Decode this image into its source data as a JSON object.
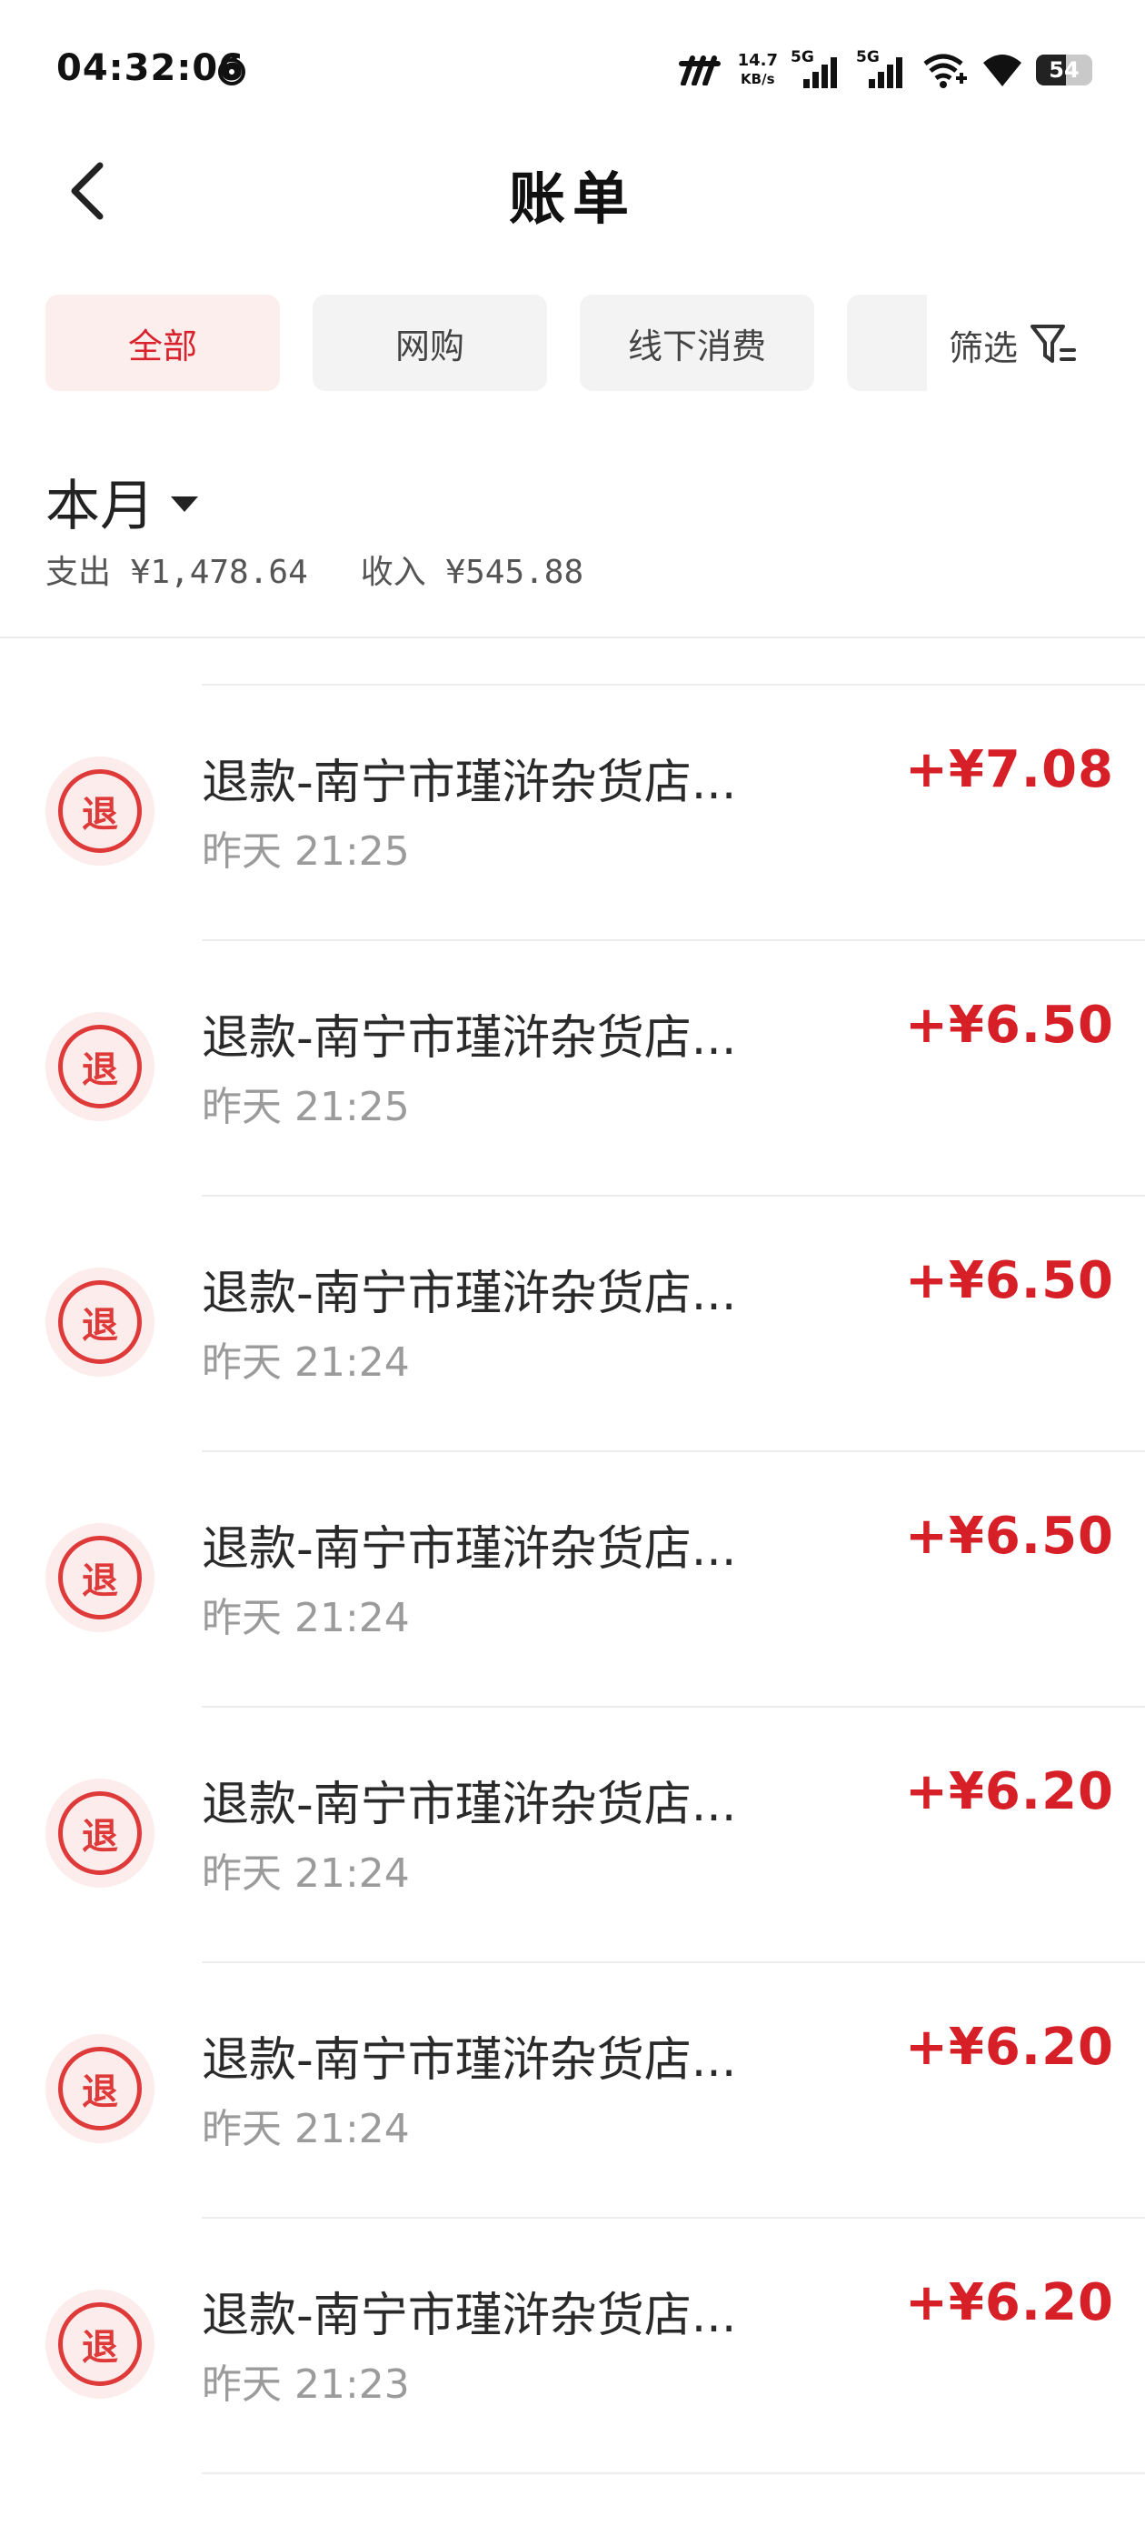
{
  "status_bar": {
    "time": "04:32:06",
    "network_speed_value": "14.7",
    "network_speed_unit": "KB/s",
    "sim1_label": "5G",
    "sim2_label": "5G",
    "battery_level": "54"
  },
  "header": {
    "title": "账单"
  },
  "tabs": [
    {
      "label": "全部",
      "active": true
    },
    {
      "label": "网购",
      "active": false
    },
    {
      "label": "线下消费",
      "active": false
    },
    {
      "label": "",
      "active": false
    }
  ],
  "filter": {
    "label": "筛选"
  },
  "summary": {
    "month_label": "本月",
    "expense": "支出 ¥1,478.64",
    "income": "收入 ¥545.88"
  },
  "transactions": [
    {
      "icon_text": "退",
      "title": "退款-南宁市瑾浒杂货店...",
      "time": "昨天 21:25",
      "amount": "+¥7.08"
    },
    {
      "icon_text": "退",
      "title": "退款-南宁市瑾浒杂货店...",
      "time": "昨天 21:25",
      "amount": "+¥6.50"
    },
    {
      "icon_text": "退",
      "title": "退款-南宁市瑾浒杂货店...",
      "time": "昨天 21:24",
      "amount": "+¥6.50"
    },
    {
      "icon_text": "退",
      "title": "退款-南宁市瑾浒杂货店...",
      "time": "昨天 21:24",
      "amount": "+¥6.50"
    },
    {
      "icon_text": "退",
      "title": "退款-南宁市瑾浒杂货店...",
      "time": "昨天 21:24",
      "amount": "+¥6.20"
    },
    {
      "icon_text": "退",
      "title": "退款-南宁市瑾浒杂货店...",
      "time": "昨天 21:24",
      "amount": "+¥6.20"
    },
    {
      "icon_text": "退",
      "title": "退款-南宁市瑾浒杂货店...",
      "time": "昨天 21:23",
      "amount": "+¥6.20"
    }
  ],
  "colors": {
    "accent_red": "#d61f26",
    "active_tab_bg": "#fdeeee",
    "tab_bg": "#f3f3f3",
    "icon_bg": "#fdecec"
  },
  "icons": {
    "back": "chevron-left-icon",
    "filter": "funnel-icon",
    "dropdown": "caret-down-icon"
  }
}
